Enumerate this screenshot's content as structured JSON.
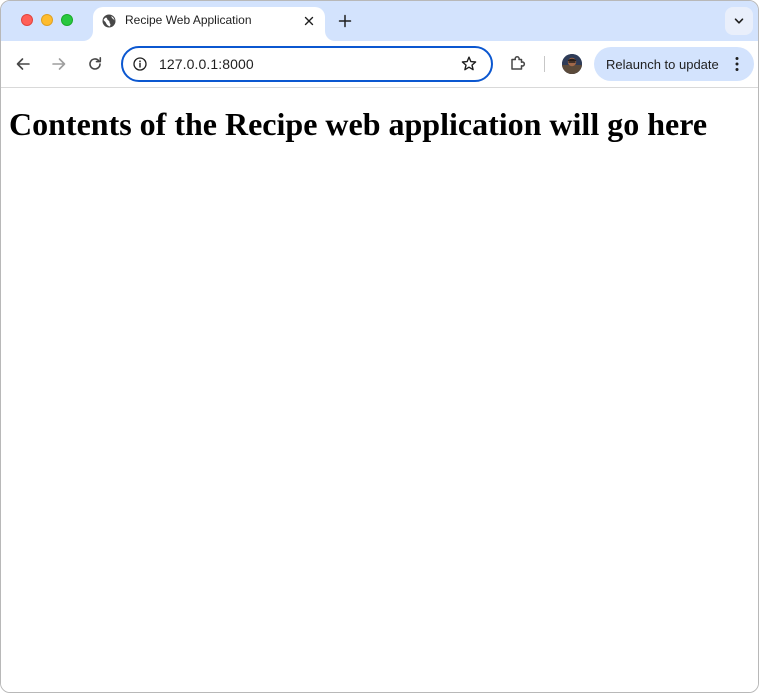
{
  "browser": {
    "tab": {
      "title": "Recipe Web Application",
      "favicon": "globe-icon"
    },
    "address_bar": {
      "url": "127.0.0.1:8000",
      "site_info_icon": "info-icon",
      "bookmark_icon": "star-icon"
    },
    "toolbar": {
      "back_icon": "arrow-left-icon",
      "forward_icon": "arrow-right-icon",
      "reload_icon": "reload-icon",
      "extensions_icon": "puzzle-icon",
      "relaunch_label": "Relaunch to update",
      "menu_icon": "more-vertical-icon"
    },
    "colors": {
      "tabstrip": "#d3e3fd",
      "omnibox_border": "#0b57d0",
      "relaunch_bg": "#d3e3fd"
    }
  },
  "page": {
    "heading": "Contents of the Recipe web application will go here"
  }
}
